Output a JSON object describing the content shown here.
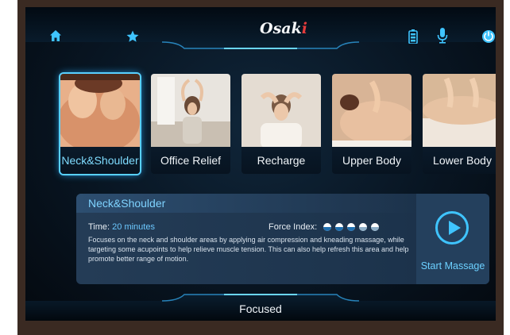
{
  "header": {
    "brand_main": "Osak",
    "brand_accent": "i",
    "icons": [
      "home-icon",
      "star-icon",
      "battery-icon",
      "microphone-icon",
      "power-icon"
    ]
  },
  "programs": [
    {
      "label": "Neck&Shoulder",
      "active": true
    },
    {
      "label": "Office Relief",
      "active": false
    },
    {
      "label": "Recharge",
      "active": false
    },
    {
      "label": "Upper Body",
      "active": false
    },
    {
      "label": "Lower Body",
      "active": false
    }
  ],
  "detail": {
    "title": "Neck&Shoulder",
    "time_label": "Time:",
    "time_value": "20 minutes",
    "force_label": "Force Index:",
    "force_level": 3,
    "force_max": 5,
    "description": "Focuses on the neck and shoulder areas by applying air compression and kneading massage, while targeting some acupoints to help relieve muscle tension. This can also help refresh this area and help promote better range of motion.",
    "start_label": "Start Massage"
  },
  "footer": {
    "mode": "Focused"
  },
  "colors": {
    "accent": "#3fc4ff",
    "brand_dot": "#e23b3b"
  }
}
